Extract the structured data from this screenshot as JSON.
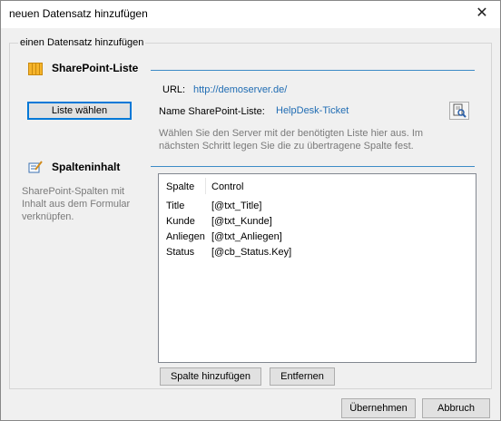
{
  "window": {
    "title": "neuen Datensatz hinzufügen",
    "close_glyph": "✕"
  },
  "group": {
    "title": "einen Datensatz hinzufügen"
  },
  "sharepoint": {
    "heading": "SharePoint-Liste",
    "choose_button": "Liste wählen",
    "url_label": "URL:",
    "url_value": "http://demoserver.de/",
    "name_label": "Name SharePoint-Liste:",
    "name_value": "HelpDesk-Ticket",
    "hint_line1": "Wählen Sie den Server mit der benötigten Liste hier aus. Im",
    "hint_line2": "nächsten Schritt legen Sie die zu übertragene Spalte fest."
  },
  "columns": {
    "heading": "Spalteninhalt",
    "desc_line1": "SharePoint-Spalten mit",
    "desc_line2": "Inhalt aus dem Formular",
    "desc_line3": "verknüpfen.",
    "header_col1": "Spalte",
    "header_col2": "Control",
    "rows": [
      {
        "spalte": "Title",
        "control": "[@txt_Title]"
      },
      {
        "spalte": "Kunde",
        "control": "[@txt_Kunde]"
      },
      {
        "spalte": "Anliegen",
        "control": "[@txt_Anliegen]"
      },
      {
        "spalte": "Status",
        "control": "[@cb_Status.Key]"
      }
    ],
    "add_button": "Spalte hinzufügen",
    "remove_button": "Entfernen"
  },
  "footer": {
    "ok_button": "Übernehmen",
    "cancel_button": "Abbruch"
  },
  "colors": {
    "accent_line": "#3c8bc6",
    "link": "#1f6cb3",
    "hint": "#7a7a7a"
  },
  "icons": {
    "sharepoint": "list-grid-icon",
    "columns": "edit-icon",
    "browse": "browse-icon"
  }
}
